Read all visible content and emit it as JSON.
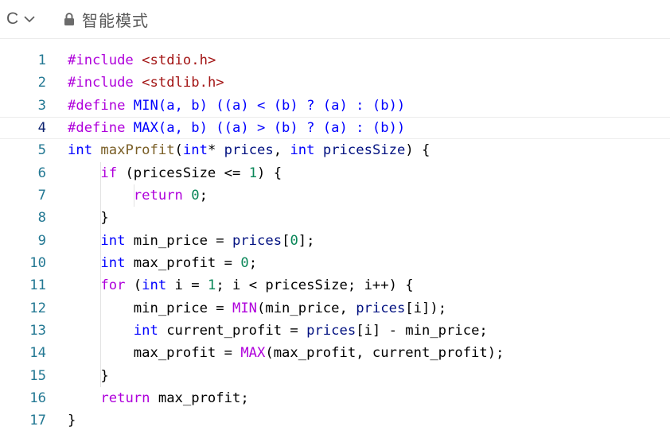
{
  "toolbar": {
    "language": "C",
    "mode_label": "智能模式"
  },
  "editor": {
    "current_line": 4,
    "lines": [
      {
        "n": "1",
        "tokens": [
          [
            "pp",
            "#include"
          ],
          [
            "",
            " "
          ],
          [
            "str",
            "<stdio.h>"
          ]
        ]
      },
      {
        "n": "2",
        "tokens": [
          [
            "pp",
            "#include"
          ],
          [
            "",
            " "
          ],
          [
            "str",
            "<stdlib.h>"
          ]
        ]
      },
      {
        "n": "3",
        "tokens": [
          [
            "pp",
            "#define"
          ],
          [
            "",
            " "
          ],
          [
            "mac",
            "MIN(a, b) ((a) < (b) ? (a) : (b))"
          ]
        ]
      },
      {
        "n": "4",
        "tokens": [
          [
            "pp",
            "#define"
          ],
          [
            "",
            " "
          ],
          [
            "mac",
            "MAX(a, b) ((a) > (b) ? (a) : (b))"
          ]
        ]
      },
      {
        "n": "5",
        "tokens": [
          [
            "kw",
            "int"
          ],
          [
            "",
            " "
          ],
          [
            "fn",
            "maxProfit"
          ],
          [
            "",
            "("
          ],
          [
            "kw",
            "int"
          ],
          [
            "",
            "* "
          ],
          [
            "var",
            "prices"
          ],
          [
            "",
            ", "
          ],
          [
            "kw",
            "int"
          ],
          [
            "",
            " "
          ],
          [
            "var",
            "pricesSize"
          ],
          [
            "",
            ") {"
          ]
        ]
      },
      {
        "n": "6",
        "tokens": [
          [
            "",
            "    "
          ],
          [
            "ctrl",
            "if"
          ],
          [
            "",
            " (pricesSize <= "
          ],
          [
            "num",
            "1"
          ],
          [
            "",
            ") {"
          ]
        ]
      },
      {
        "n": "7",
        "tokens": [
          [
            "",
            "        "
          ],
          [
            "ctrl",
            "return"
          ],
          [
            "",
            " "
          ],
          [
            "num",
            "0"
          ],
          [
            "",
            ";"
          ]
        ]
      },
      {
        "n": "8",
        "tokens": [
          [
            "",
            "    }"
          ]
        ]
      },
      {
        "n": "9",
        "tokens": [
          [
            "",
            "    "
          ],
          [
            "kw",
            "int"
          ],
          [
            "",
            " min_price = "
          ],
          [
            "var",
            "prices"
          ],
          [
            "",
            "["
          ],
          [
            "num",
            "0"
          ],
          [
            "",
            "];"
          ]
        ]
      },
      {
        "n": "10",
        "tokens": [
          [
            "",
            "    "
          ],
          [
            "kw",
            "int"
          ],
          [
            "",
            " max_profit = "
          ],
          [
            "num",
            "0"
          ],
          [
            "",
            ";"
          ]
        ]
      },
      {
        "n": "11",
        "tokens": [
          [
            "",
            "    "
          ],
          [
            "ctrl",
            "for"
          ],
          [
            "",
            " ("
          ],
          [
            "kw",
            "int"
          ],
          [
            "",
            " i = "
          ],
          [
            "num",
            "1"
          ],
          [
            "",
            "; i < pricesSize; i++) {"
          ]
        ]
      },
      {
        "n": "12",
        "tokens": [
          [
            "",
            "        min_price = "
          ],
          [
            "pp",
            "MIN"
          ],
          [
            "",
            "(min_price, "
          ],
          [
            "var",
            "prices"
          ],
          [
            "",
            "[i]);"
          ]
        ]
      },
      {
        "n": "13",
        "tokens": [
          [
            "",
            "        "
          ],
          [
            "kw",
            "int"
          ],
          [
            "",
            " current_profit = "
          ],
          [
            "var",
            "prices"
          ],
          [
            "",
            "[i] - min_price;"
          ]
        ]
      },
      {
        "n": "14",
        "tokens": [
          [
            "",
            "        max_profit = "
          ],
          [
            "pp",
            "MAX"
          ],
          [
            "",
            "(max_profit, current_profit);"
          ]
        ]
      },
      {
        "n": "15",
        "tokens": [
          [
            "",
            "    }"
          ]
        ]
      },
      {
        "n": "16",
        "tokens": [
          [
            "",
            "    "
          ],
          [
            "ctrl",
            "return"
          ],
          [
            "",
            " max_profit;"
          ]
        ]
      },
      {
        "n": "17",
        "tokens": [
          [
            "",
            "}"
          ]
        ]
      }
    ]
  }
}
